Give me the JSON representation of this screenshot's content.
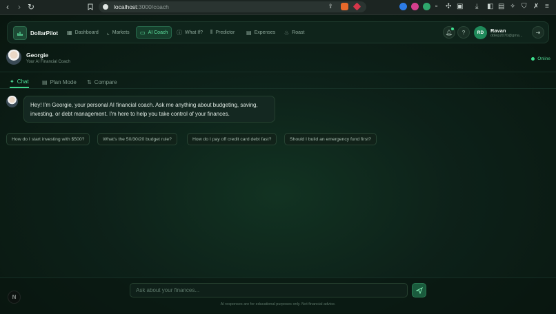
{
  "browser": {
    "url_host": "localhost",
    "url_path": ":3000/coach"
  },
  "brand": {
    "name": "DollarPilot"
  },
  "nav": [
    {
      "label": "Dashboard",
      "icon": "grid-icon"
    },
    {
      "label": "Markets",
      "icon": "chart-icon"
    },
    {
      "label": "AI Coach",
      "icon": "chat-icon",
      "active": true
    },
    {
      "label": "What If?",
      "icon": "question-icon"
    },
    {
      "label": "Predictor",
      "icon": "bars-icon"
    },
    {
      "label": "Expenses",
      "icon": "receipt-icon"
    },
    {
      "label": "Roast",
      "icon": "flame-icon"
    }
  ],
  "user": {
    "initials": "RD",
    "name": "Ravan",
    "email": "ddeip2070@gma..."
  },
  "coach": {
    "name": "Georgie",
    "role": "Your AI Financial Coach",
    "status": "Online"
  },
  "tabs": [
    {
      "label": "Chat",
      "active": true
    },
    {
      "label": "Plan Mode"
    },
    {
      "label": "Compare"
    }
  ],
  "message": "Hey! I'm Georgie, your personal AI financial coach. Ask me anything about budgeting, saving, investing, or debt management. I'm here to help you take control of your finances.",
  "suggestions": [
    "How do I start investing with $500?",
    "What's the 50/30/20 budget rule?",
    "How do I pay off credit card debt fast?",
    "Should I build an emergency fund first?"
  ],
  "input": {
    "placeholder": "Ask about your finances..."
  },
  "disclaimer": "AI responses are for educational purposes only. Not financial advice.",
  "dev_badge": "N",
  "colors": {
    "accent": "#3ee08f",
    "background": "#0b1a14"
  }
}
